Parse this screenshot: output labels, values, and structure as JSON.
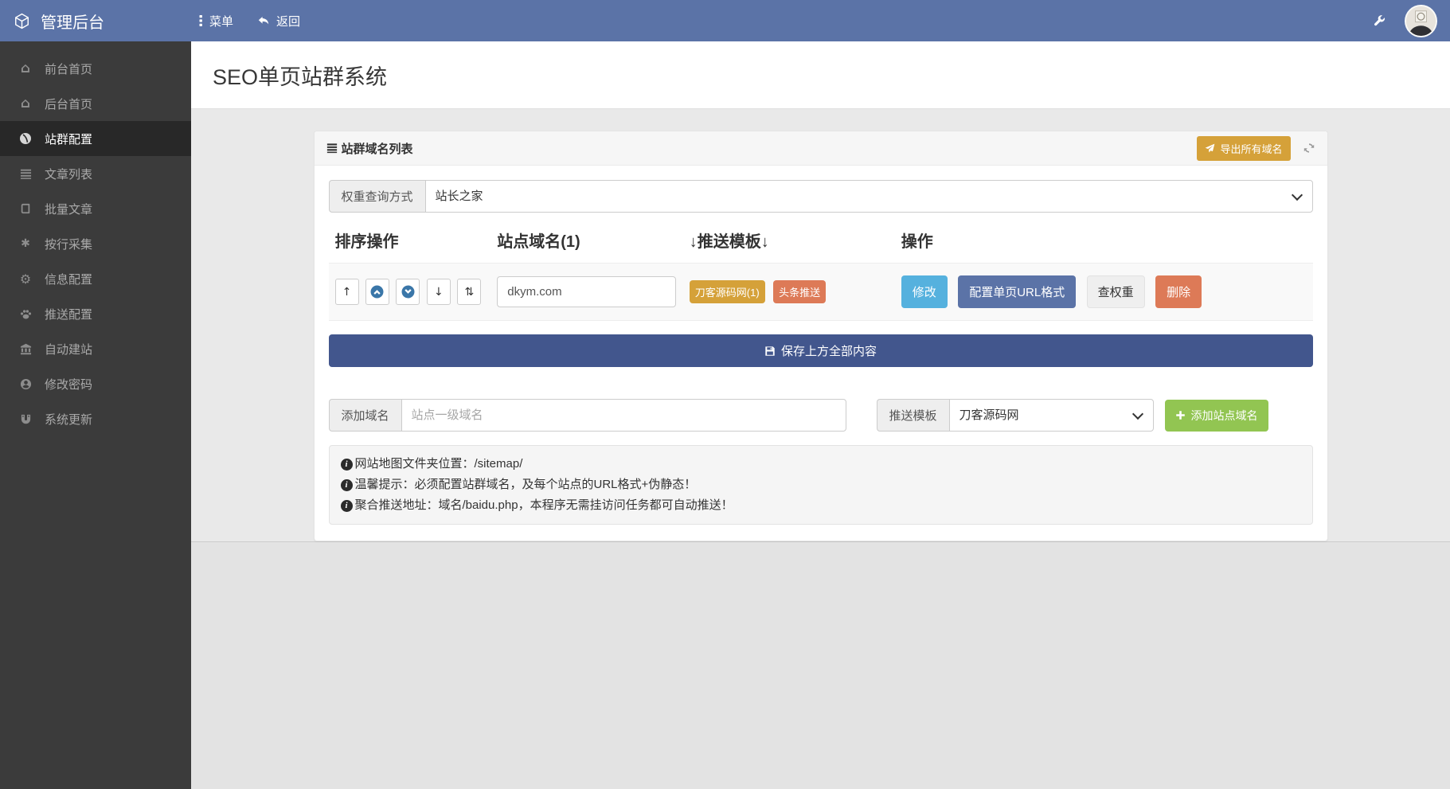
{
  "navbar": {
    "brand": "管理后台",
    "menu_label": "菜单",
    "back_label": "返回"
  },
  "sidebar": {
    "items": [
      {
        "label": "前台首页",
        "icon": "home-icon",
        "active": false
      },
      {
        "label": "后台首页",
        "icon": "home-icon",
        "active": false
      },
      {
        "label": "站群配置",
        "icon": "globe-icon",
        "active": true
      },
      {
        "label": "文章列表",
        "icon": "list-icon",
        "active": false
      },
      {
        "label": "批量文章",
        "icon": "book-icon",
        "active": false
      },
      {
        "label": "按行采集",
        "icon": "asterisk-icon",
        "active": false
      },
      {
        "label": "信息配置",
        "icon": "cog-icon",
        "active": false
      },
      {
        "label": "推送配置",
        "icon": "paw-icon",
        "active": false
      },
      {
        "label": "自动建站",
        "icon": "bank-icon",
        "active": false
      },
      {
        "label": "修改密码",
        "icon": "user-icon",
        "active": false
      },
      {
        "label": "系统更新",
        "icon": "magnet-icon",
        "active": false
      }
    ]
  },
  "page": {
    "title": "SEO单页站群系统"
  },
  "panel": {
    "title": "站群域名列表",
    "export_button": "导出所有域名",
    "weight_query": {
      "label": "权重查询方式",
      "value": "站长之家"
    },
    "table": {
      "headers": [
        "排序操作",
        "站点域名(1)",
        "↓推送模板↓",
        "操作"
      ],
      "row": {
        "domain": "dkym.com",
        "badges": [
          {
            "label": "刀客源码网(1)",
            "color": "#d5a139"
          },
          {
            "label": "头条推送",
            "color": "#dd7a57"
          }
        ],
        "actions": [
          {
            "label": "修改",
            "style": "info",
            "color": "#55b1de"
          },
          {
            "label": "配置单页URL格式",
            "style": "primary",
            "color": "#5b73a7"
          },
          {
            "label": "查权重",
            "style": "default",
            "color": "#efefef"
          },
          {
            "label": "删除",
            "style": "danger",
            "color": "#dd7a57"
          }
        ]
      }
    },
    "save_button": "保存上方全部内容",
    "add_domain": {
      "label": "添加域名",
      "placeholder": "站点一级域名"
    },
    "push_template": {
      "label": "推送模板",
      "value": "刀客源码网"
    },
    "add_button": "添加站点域名",
    "notes": [
      "网站地图文件夹位置：/sitemap/",
      "温馨提示：必须配置站群域名，及每个站点的URL格式+伪静态！",
      "聚合推送地址：域名/baidu.php，本程序无需挂访问任务都可自动推送！"
    ]
  },
  "colors": {
    "navbar": "#5b73a7",
    "sidebar": "#3b3b3b",
    "save_button": "#42568d",
    "export_button": "#d5a139",
    "add_button": "#92c552"
  }
}
